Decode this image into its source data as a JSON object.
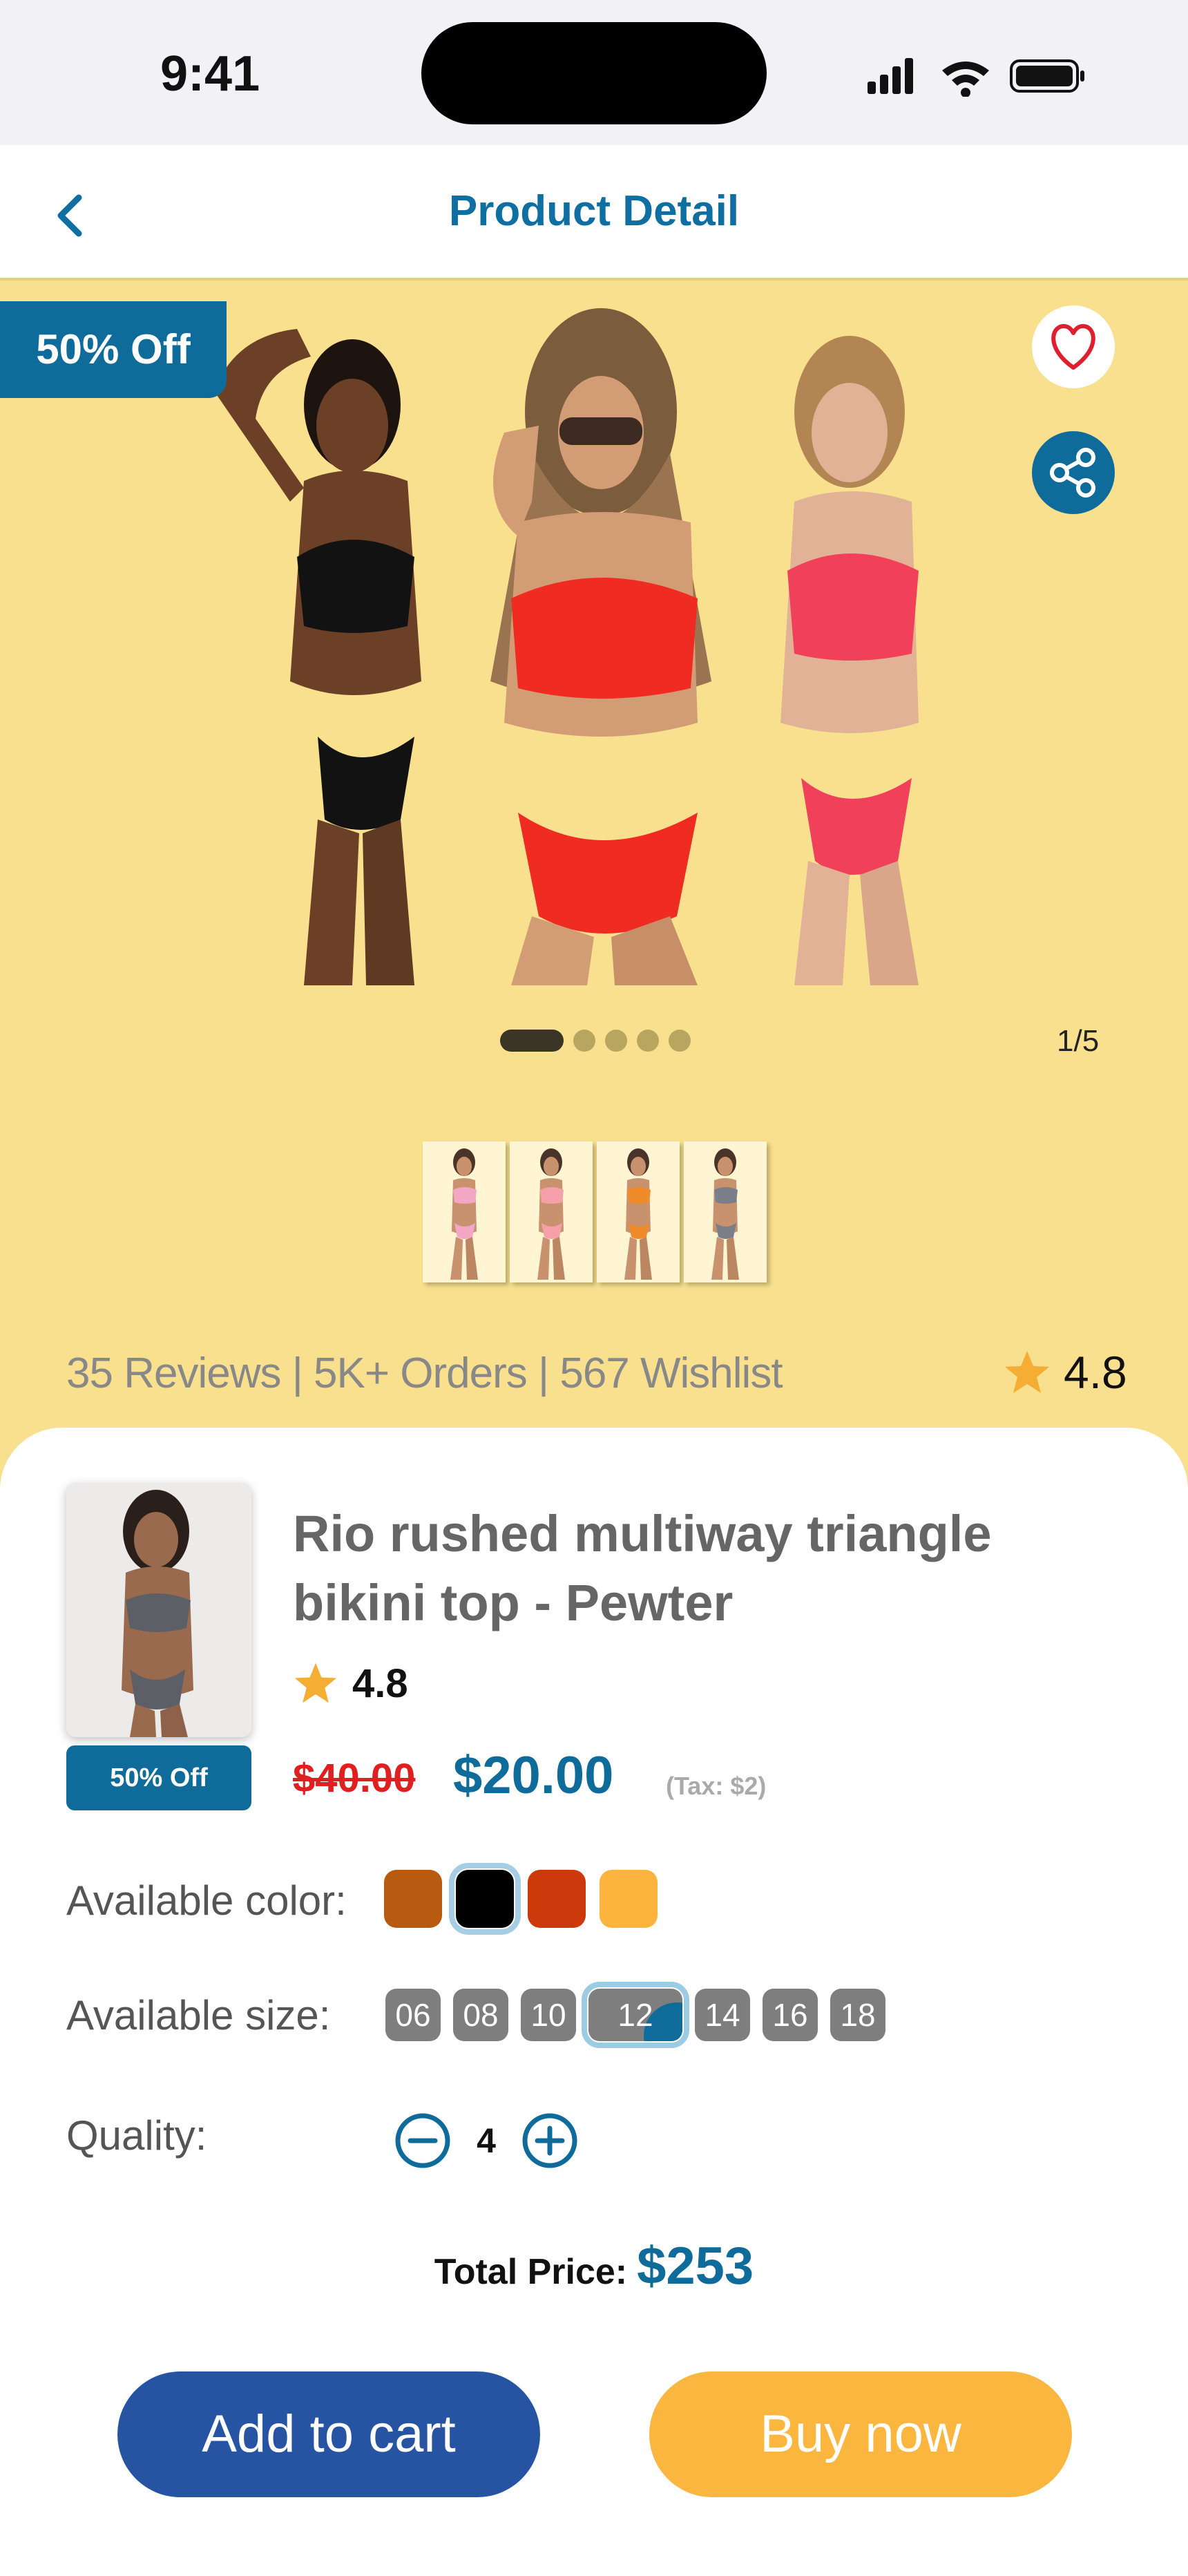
{
  "status": {
    "time": "9:41"
  },
  "header": {
    "title": "Product Detail"
  },
  "hero": {
    "discount": "50% Off",
    "pager": "1/5",
    "dots_total": 5,
    "dots_active": 1,
    "thumbnails": [
      {
        "color": "#f4a7c4"
      },
      {
        "color": "#f5a0a8"
      },
      {
        "color": "#f08b2a"
      },
      {
        "color": "#7a7f8a"
      }
    ],
    "reviews_line": "35 Reviews | 5K+ Orders | 567 Wishlist",
    "rating": "4.8"
  },
  "product": {
    "title": "Rio rushed multiway triangle bikini top - Pewter",
    "badge": "50% Off",
    "rating": "4.8",
    "old_price": "$40.00",
    "price": "$20.00",
    "tax": "(Tax: $2)",
    "color_label": "Available color:",
    "colors": [
      {
        "hex": "#b85a10",
        "selected": false
      },
      {
        "hex": "#000000",
        "selected": true
      },
      {
        "hex": "#cc3a0c",
        "selected": false
      },
      {
        "hex": "#fdb43f",
        "selected": false
      }
    ],
    "size_label": "Available size:",
    "sizes": [
      "06",
      "08",
      "10",
      "12",
      "14",
      "16",
      "18"
    ],
    "selected_size": "12",
    "quantity_label": "Quality:",
    "quantity": "4",
    "total_label": "Total Price:",
    "total_value": "$253"
  },
  "actions": {
    "add_to_cart": "Add to cart",
    "buy_now": "Buy now"
  },
  "colors": {
    "brand_blue": "#0e6b9a",
    "cart_blue": "#2654a3",
    "buy_yellow": "#fbb63f",
    "hero_bg": "#f8e08e"
  }
}
